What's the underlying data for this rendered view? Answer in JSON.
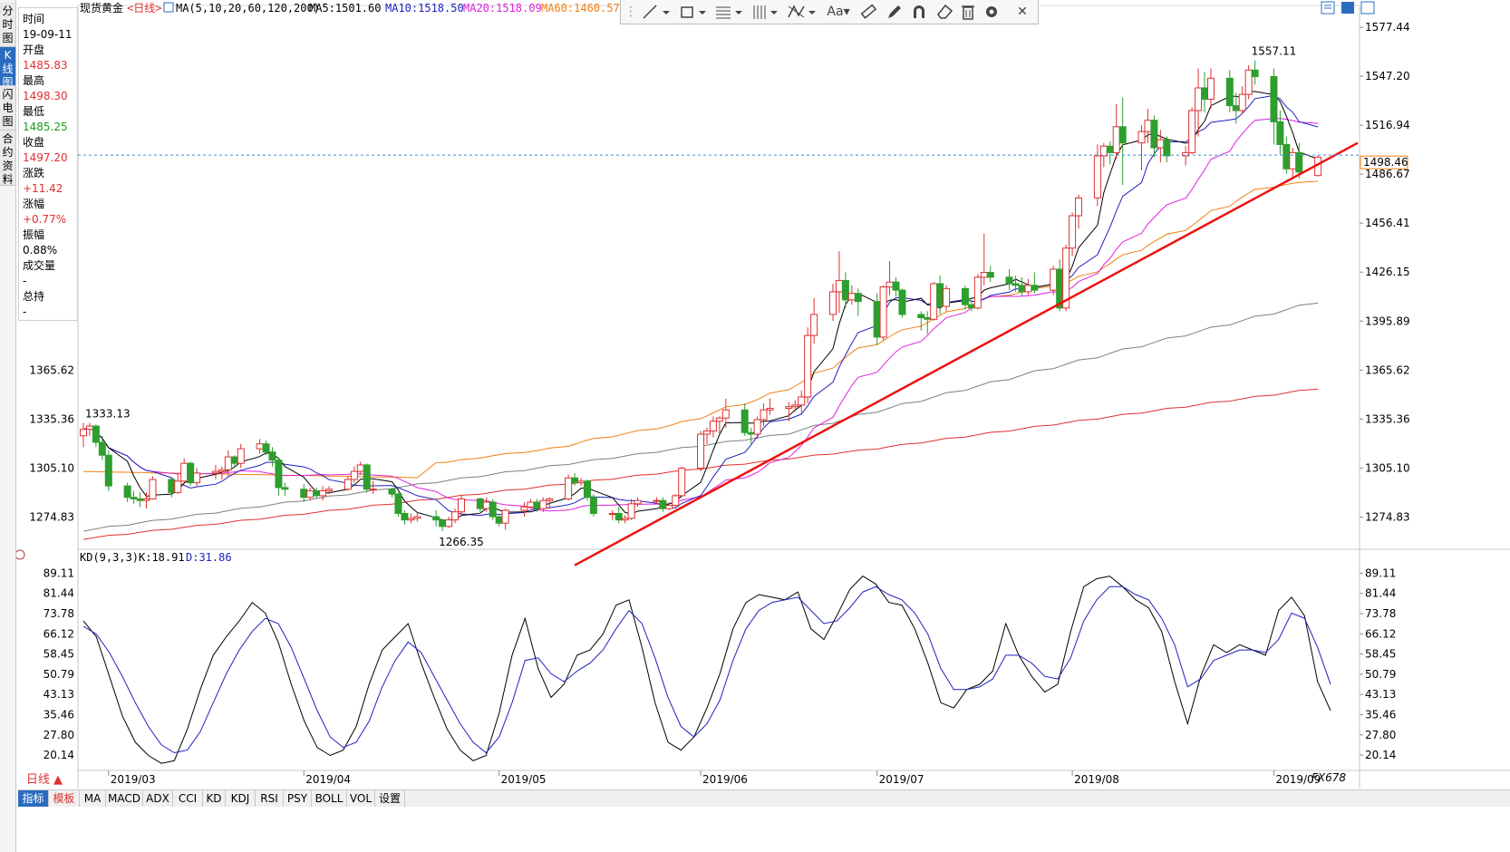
{
  "sidebar_tabs": [
    "分时图",
    "K线图",
    "闪电图",
    "合约资料"
  ],
  "header": {
    "instrument": "现货黄金",
    "period": "<日线>",
    "ma_setting": "MA(5,10,20,60,120,200)",
    "ma5": "MA5:1501.60",
    "ma10": "MA10:1518.50",
    "ma20": "MA20:1518.09",
    "ma60": "MA60:1460.57"
  },
  "info_panel": {
    "time_label": "时间",
    "time_value": "19-09-11",
    "open_label": "开盘",
    "open_value": "1485.83",
    "high_label": "最高",
    "high_value": "1498.30",
    "low_label": "最低",
    "low_value": "1485.25",
    "close_label": "收盘",
    "close_value": "1497.20",
    "change_label": "涨跌",
    "change_value": "+11.42",
    "pct_label": "涨幅",
    "pct_value": "+0.77%",
    "amp_label": "振幅",
    "amp_value": "0.88%",
    "vol_label": "成交量",
    "vol_value": "-",
    "oi_label": "总持",
    "oi_value": "-"
  },
  "toolbar_icons": [
    "line-tool-icon",
    "rect-tool-icon",
    "fib-tool-icon",
    "parallel-tool-icon",
    "pattern-tool-icon",
    "text-tool-icon",
    "ruler-icon",
    "pen-icon",
    "magnet-icon",
    "eraser-icon",
    "trash-icon",
    "gear-icon",
    "close-icon"
  ],
  "toolbar_text": "Aa",
  "price_labels_right": [
    "1577.44",
    "1547.20",
    "1516.94",
    "1486.67",
    "1456.41",
    "1426.15",
    "1395.89",
    "1365.62",
    "1335.36",
    "1305.10",
    "1274.83"
  ],
  "price_labels_left": [
    "1365.62",
    "1335.36",
    "1305.10",
    "1274.83"
  ],
  "current_price": "1498.46",
  "annotations": {
    "high": "1557.11",
    "low": "1266.35",
    "early_high": "1333.13"
  },
  "kd": {
    "label": "KD(9,3,3)",
    "k_text": "K:18.91",
    "d_text": "D:31.86",
    "levels": [
      "89.11",
      "81.44",
      "73.78",
      "66.12",
      "58.45",
      "50.79",
      "43.13",
      "35.46",
      "27.80",
      "20.14"
    ],
    "levels_left": [
      "89.11",
      "81.44",
      "73.78",
      "66.12",
      "58.45",
      "50.79",
      "43.13",
      "35.46",
      "27.80",
      "20.14"
    ]
  },
  "months": [
    "2019/03",
    "2019/04",
    "2019/05",
    "2019/06",
    "2019/07",
    "2019/08",
    "2019/09"
  ],
  "period_button": "日线 ▲",
  "bottom_tabs": [
    "指标",
    "模板",
    "MA",
    "MACD",
    "ADX",
    "CCI",
    "KD",
    "KDJ",
    "RSI",
    "PSY",
    "BOLL",
    "VOL",
    "设置"
  ],
  "watermark": "FX678",
  "colors": {
    "up": "#e03030",
    "down": "#2e9e2e",
    "ma5": "#000000",
    "ma10": "#2020c0",
    "ma20": "#e020e0",
    "ma60": "#f08010",
    "ma120": "#808080",
    "ma200": "#e03030",
    "trendline": "#ee1111",
    "price_line": "#3a8fd8",
    "price_tag": "#f08010"
  },
  "chart_data": {
    "type": "candlestick",
    "x_range": [
      "2019-02-25",
      "2019-09-11"
    ],
    "ylim": [
      1256,
      1582
    ],
    "kd_ylim": [
      15,
      92
    ],
    "ohlc_dates": [
      "2019-02-25",
      "2019-02-26",
      "2019-02-27",
      "2019-02-28",
      "2019-03-01",
      "2019-03-04",
      "2019-03-05",
      "2019-03-06",
      "2019-03-07",
      "2019-03-08",
      "2019-03-11",
      "2019-03-12",
      "2019-03-13",
      "2019-03-14",
      "2019-03-15",
      "2019-03-18",
      "2019-03-19",
      "2019-03-20",
      "2019-03-21",
      "2019-03-22",
      "2019-03-25",
      "2019-03-26",
      "2019-03-27",
      "2019-03-28",
      "2019-03-29",
      "2019-04-01",
      "2019-04-02",
      "2019-04-03",
      "2019-04-04",
      "2019-04-05",
      "2019-04-08",
      "2019-04-09",
      "2019-04-10",
      "2019-04-11",
      "2019-04-12",
      "2019-04-15",
      "2019-04-16",
      "2019-04-17",
      "2019-04-18",
      "2019-04-19",
      "2019-04-22",
      "2019-04-23",
      "2019-04-24",
      "2019-04-25",
      "2019-04-26",
      "2019-04-29",
      "2019-04-30",
      "2019-05-01",
      "2019-05-02",
      "2019-05-03",
      "2019-05-06",
      "2019-05-07",
      "2019-05-08",
      "2019-05-09",
      "2019-05-10",
      "2019-05-13",
      "2019-05-14",
      "2019-05-15",
      "2019-05-16",
      "2019-05-17",
      "2019-05-20",
      "2019-05-21",
      "2019-05-22",
      "2019-05-23",
      "2019-05-24",
      "2019-05-27",
      "2019-05-28",
      "2019-05-29",
      "2019-05-30",
      "2019-05-31",
      "2019-06-03",
      "2019-06-04",
      "2019-06-05",
      "2019-06-06",
      "2019-06-07",
      "2019-06-10",
      "2019-06-11",
      "2019-06-12",
      "2019-06-13",
      "2019-06-14",
      "2019-06-17",
      "2019-06-18",
      "2019-06-19",
      "2019-06-20",
      "2019-06-21",
      "2019-06-24",
      "2019-06-25",
      "2019-06-26",
      "2019-06-27",
      "2019-06-28",
      "2019-07-01",
      "2019-07-02",
      "2019-07-03",
      "2019-07-04",
      "2019-07-05",
      "2019-07-08",
      "2019-07-09",
      "2019-07-10",
      "2019-07-11",
      "2019-07-12",
      "2019-07-15",
      "2019-07-16",
      "2019-07-17",
      "2019-07-18",
      "2019-07-19",
      "2019-07-22",
      "2019-07-23",
      "2019-07-24",
      "2019-07-25",
      "2019-07-26",
      "2019-07-29",
      "2019-07-30",
      "2019-07-31",
      "2019-08-01",
      "2019-08-02",
      "2019-08-05",
      "2019-08-06",
      "2019-08-07",
      "2019-08-08",
      "2019-08-09",
      "2019-08-12",
      "2019-08-13",
      "2019-08-14",
      "2019-08-15",
      "2019-08-16",
      "2019-08-19",
      "2019-08-20",
      "2019-08-21",
      "2019-08-22",
      "2019-08-23",
      "2019-08-26",
      "2019-08-27",
      "2019-08-28",
      "2019-08-29",
      "2019-08-30",
      "2019-09-02",
      "2019-09-03",
      "2019-09-04",
      "2019-09-05",
      "2019-09-06",
      "2019-09-09",
      "2019-09-10",
      "2019-09-11"
    ],
    "ohlc": [
      [
        1325,
        1333,
        1318,
        1329
      ],
      [
        1329,
        1333,
        1325,
        1331
      ],
      [
        1331,
        1332,
        1318,
        1321
      ],
      [
        1321,
        1325,
        1310,
        1313
      ],
      [
        1313,
        1316,
        1291,
        1294
      ],
      [
        1294,
        1296,
        1284,
        1287
      ],
      [
        1287,
        1291,
        1283,
        1286
      ],
      [
        1286,
        1290,
        1281,
        1285
      ],
      [
        1285,
        1290,
        1280,
        1286
      ],
      [
        1286,
        1300,
        1286,
        1298
      ],
      [
        1298,
        1299,
        1287,
        1290
      ],
      [
        1290,
        1302,
        1289,
        1297
      ],
      [
        1297,
        1311,
        1296,
        1308
      ],
      [
        1308,
        1309,
        1294,
        1296
      ],
      [
        1296,
        1305,
        1294,
        1302
      ],
      [
        1302,
        1307,
        1298,
        1303
      ],
      [
        1303,
        1306,
        1298,
        1304
      ],
      [
        1304,
        1316,
        1300,
        1312
      ],
      [
        1312,
        1313,
        1305,
        1308
      ],
      [
        1308,
        1320,
        1305,
        1317
      ],
      [
        1317,
        1323,
        1314,
        1320
      ],
      [
        1320,
        1322,
        1313,
        1315
      ],
      [
        1315,
        1318,
        1306,
        1310
      ],
      [
        1310,
        1311,
        1288,
        1293
      ],
      [
        1293,
        1296,
        1288,
        1292
      ],
      [
        1292,
        1295,
        1284,
        1287
      ],
      [
        1287,
        1293,
        1285,
        1291
      ],
      [
        1291,
        1293,
        1286,
        1288
      ],
      [
        1288,
        1294,
        1285,
        1291
      ],
      [
        1291,
        1294,
        1289,
        1292
      ],
      [
        1292,
        1300,
        1291,
        1298
      ],
      [
        1298,
        1306,
        1296,
        1303
      ],
      [
        1303,
        1309,
        1301,
        1307
      ],
      [
        1307,
        1308,
        1290,
        1292
      ],
      [
        1292,
        1297,
        1289,
        1292
      ],
      [
        1292,
        1293,
        1287,
        1289
      ],
      [
        1289,
        1290,
        1275,
        1277
      ],
      [
        1277,
        1279,
        1270,
        1273
      ],
      [
        1273,
        1277,
        1271,
        1274
      ],
      [
        1274,
        1278,
        1272,
        1275
      ],
      [
        1275,
        1279,
        1269,
        1273
      ],
      [
        1273,
        1274,
        1266,
        1269
      ],
      [
        1269,
        1275,
        1268,
        1273
      ],
      [
        1273,
        1280,
        1271,
        1278
      ],
      [
        1278,
        1288,
        1276,
        1286
      ],
      [
        1286,
        1287,
        1278,
        1280
      ],
      [
        1280,
        1287,
        1278,
        1284
      ],
      [
        1284,
        1286,
        1273,
        1275
      ],
      [
        1275,
        1276,
        1269,
        1271
      ],
      [
        1271,
        1280,
        1267,
        1279
      ],
      [
        1279,
        1284,
        1275,
        1281
      ],
      [
        1281,
        1286,
        1280,
        1284
      ],
      [
        1284,
        1286,
        1278,
        1280
      ],
      [
        1280,
        1287,
        1278,
        1285
      ],
      [
        1285,
        1287,
        1280,
        1286
      ],
      [
        1286,
        1301,
        1285,
        1299
      ],
      [
        1299,
        1302,
        1294,
        1296
      ],
      [
        1296,
        1299,
        1294,
        1297
      ],
      [
        1297,
        1298,
        1285,
        1287
      ],
      [
        1287,
        1289,
        1275,
        1277
      ],
      [
        1277,
        1279,
        1273,
        1277
      ],
      [
        1277,
        1281,
        1271,
        1273
      ],
      [
        1273,
        1276,
        1271,
        1274
      ],
      [
        1274,
        1286,
        1273,
        1283
      ],
      [
        1283,
        1287,
        1281,
        1285
      ],
      [
        1285,
        1287,
        1283,
        1285
      ],
      [
        1285,
        1287,
        1278,
        1280
      ],
      [
        1280,
        1284,
        1279,
        1282
      ],
      [
        1282,
        1289,
        1281,
        1288
      ],
      [
        1288,
        1306,
        1287,
        1305
      ],
      [
        1305,
        1328,
        1303,
        1326
      ],
      [
        1326,
        1330,
        1320,
        1328
      ],
      [
        1328,
        1337,
        1324,
        1334
      ],
      [
        1334,
        1337,
        1326,
        1336
      ],
      [
        1336,
        1348,
        1330,
        1341
      ],
      [
        1341,
        1345,
        1325,
        1327
      ],
      [
        1327,
        1330,
        1320,
        1326
      ],
      [
        1326,
        1337,
        1323,
        1335
      ],
      [
        1335,
        1345,
        1331,
        1341
      ],
      [
        1341,
        1348,
        1338,
        1342
      ],
      [
        1342,
        1346,
        1334,
        1343
      ],
      [
        1343,
        1347,
        1340,
        1344
      ],
      [
        1344,
        1353,
        1339,
        1349
      ],
      [
        1349,
        1392,
        1345,
        1387
      ],
      [
        1387,
        1410,
        1382,
        1400
      ],
      [
        1400,
        1419,
        1396,
        1414
      ],
      [
        1414,
        1439,
        1401,
        1421
      ],
      [
        1421,
        1426,
        1404,
        1409
      ],
      [
        1409,
        1418,
        1406,
        1413
      ],
      [
        1413,
        1416,
        1399,
        1408
      ],
      [
        1408,
        1413,
        1381,
        1386
      ],
      [
        1386,
        1418,
        1384,
        1417
      ],
      [
        1417,
        1433,
        1412,
        1420
      ],
      [
        1420,
        1423,
        1411,
        1415
      ],
      [
        1415,
        1416,
        1398,
        1400
      ],
      [
        1400,
        1402,
        1390,
        1398
      ],
      [
        1398,
        1402,
        1388,
        1397
      ],
      [
        1397,
        1420,
        1396,
        1419
      ],
      [
        1419,
        1424,
        1400,
        1405
      ],
      [
        1405,
        1418,
        1402,
        1416
      ],
      [
        1416,
        1418,
        1403,
        1406
      ],
      [
        1406,
        1410,
        1402,
        1404
      ],
      [
        1404,
        1425,
        1403,
        1423
      ],
      [
        1423,
        1450,
        1418,
        1426
      ],
      [
        1426,
        1430,
        1420,
        1423
      ],
      [
        1423,
        1428,
        1415,
        1419
      ],
      [
        1419,
        1424,
        1414,
        1418
      ],
      [
        1418,
        1423,
        1411,
        1414
      ],
      [
        1414,
        1422,
        1412,
        1418
      ],
      [
        1418,
        1426,
        1413,
        1415
      ],
      [
        1415,
        1430,
        1412,
        1428
      ],
      [
        1428,
        1434,
        1402,
        1404
      ],
      [
        1404,
        1443,
        1402,
        1441
      ],
      [
        1441,
        1463,
        1436,
        1461
      ],
      [
        1461,
        1474,
        1453,
        1472
      ],
      [
        1472,
        1505,
        1467,
        1498
      ],
      [
        1498,
        1506,
        1491,
        1504
      ],
      [
        1504,
        1507,
        1493,
        1500
      ],
      [
        1500,
        1530,
        1496,
        1516
      ],
      [
        1516,
        1534,
        1480,
        1506
      ],
      [
        1506,
        1517,
        1489,
        1513
      ],
      [
        1513,
        1527,
        1506,
        1520
      ],
      [
        1520,
        1523,
        1497,
        1503
      ],
      [
        1503,
        1514,
        1494,
        1508
      ],
      [
        1508,
        1510,
        1494,
        1498
      ],
      [
        1498,
        1504,
        1492,
        1500
      ],
      [
        1500,
        1528,
        1499,
        1526
      ],
      [
        1526,
        1552,
        1510,
        1540
      ],
      [
        1540,
        1550,
        1525,
        1533
      ],
      [
        1533,
        1552,
        1527,
        1546
      ],
      [
        1546,
        1551,
        1525,
        1529
      ],
      [
        1529,
        1537,
        1518,
        1526
      ],
      [
        1526,
        1541,
        1524,
        1536
      ],
      [
        1536,
        1554,
        1533,
        1551
      ],
      [
        1551,
        1557,
        1542,
        1547
      ],
      [
        1547,
        1552,
        1505,
        1519
      ],
      [
        1519,
        1526,
        1499,
        1505
      ],
      [
        1505,
        1510,
        1487,
        1490
      ],
      [
        1490,
        1503,
        1485,
        1500
      ],
      [
        1500,
        1506,
        1484,
        1488
      ],
      [
        1485.83,
        1498.3,
        1485.25,
        1497.2
      ]
    ],
    "kd_k": [
      71,
      65,
      50,
      35,
      25,
      20,
      17,
      18,
      30,
      45,
      58,
      65,
      71,
      78,
      74,
      63,
      47,
      33,
      23,
      20,
      22,
      31,
      47,
      60,
      65,
      70,
      55,
      42,
      30,
      22,
      18,
      20,
      36,
      58,
      72,
      53,
      42,
      47,
      58,
      60,
      66,
      77,
      79,
      61,
      40,
      25,
      22,
      27,
      38,
      51,
      68,
      78,
      81,
      80,
      79,
      82,
      68,
      64,
      73,
      83,
      88,
      85,
      78,
      77,
      68,
      55,
      40,
      38,
      45,
      47,
      52,
      70,
      58,
      50,
      44,
      47,
      67,
      84,
      87,
      88,
      84,
      79,
      76,
      67,
      48,
      32,
      50,
      62,
      59,
      62,
      60,
      58,
      75,
      80,
      73,
      48,
      37
    ],
    "kd_d": [
      69,
      66,
      59,
      50,
      40,
      31,
      24,
      21,
      22,
      29,
      40,
      51,
      60,
      67,
      72,
      70,
      61,
      49,
      37,
      27,
      23,
      25,
      33,
      46,
      56,
      63,
      59,
      50,
      41,
      32,
      25,
      21,
      27,
      40,
      56,
      57,
      51,
      48,
      52,
      55,
      60,
      68,
      75,
      70,
      57,
      42,
      31,
      27,
      32,
      41,
      56,
      68,
      75,
      78,
      79,
      80,
      75,
      70,
      71,
      76,
      82,
      84,
      81,
      79,
      74,
      66,
      53,
      45,
      45,
      46,
      49,
      58,
      58,
      55,
      50,
      49,
      57,
      71,
      79,
      84,
      84,
      81,
      79,
      72,
      62,
      46,
      49,
      56,
      58,
      60,
      60,
      59,
      64,
      74,
      72,
      61,
      47
    ],
    "kd_k_last": 18.91,
    "kd_d_last": 31.86
  }
}
